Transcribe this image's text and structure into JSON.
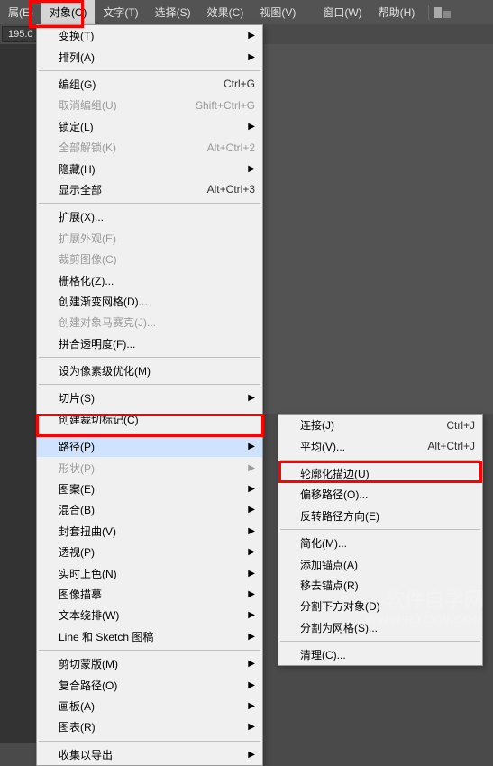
{
  "menubar": {
    "items": [
      {
        "label": "属(E)"
      },
      {
        "label": "对象(O)"
      },
      {
        "label": "文字(T)"
      },
      {
        "label": "选择(S)"
      },
      {
        "label": "效果(C)"
      },
      {
        "label": "视图(V)"
      },
      {
        "label": "窗口(W)"
      },
      {
        "label": "帮助(H)"
      }
    ]
  },
  "toolbar": {
    "value": "195.0"
  },
  "dropdown_main": [
    {
      "type": "item",
      "label": "变换(T)",
      "arrow": true
    },
    {
      "type": "item",
      "label": "排列(A)",
      "arrow": true
    },
    {
      "type": "sep"
    },
    {
      "type": "item",
      "label": "编组(G)",
      "shortcut": "Ctrl+G"
    },
    {
      "type": "item",
      "label": "取消编组(U)",
      "shortcut": "Shift+Ctrl+G",
      "disabled": true
    },
    {
      "type": "item",
      "label": "锁定(L)",
      "arrow": true
    },
    {
      "type": "item",
      "label": "全部解锁(K)",
      "shortcut": "Alt+Ctrl+2",
      "disabled": true
    },
    {
      "type": "item",
      "label": "隐藏(H)",
      "arrow": true
    },
    {
      "type": "item",
      "label": "显示全部",
      "shortcut": "Alt+Ctrl+3"
    },
    {
      "type": "sep"
    },
    {
      "type": "item",
      "label": "扩展(X)..."
    },
    {
      "type": "item",
      "label": "扩展外观(E)",
      "disabled": true
    },
    {
      "type": "item",
      "label": "裁剪图像(C)",
      "disabled": true
    },
    {
      "type": "item",
      "label": "栅格化(Z)..."
    },
    {
      "type": "item",
      "label": "创建渐变网格(D)..."
    },
    {
      "type": "item",
      "label": "创建对象马赛克(J)...",
      "disabled": true
    },
    {
      "type": "item",
      "label": "拼合透明度(F)..."
    },
    {
      "type": "sep"
    },
    {
      "type": "item",
      "label": "设为像素级优化(M)"
    },
    {
      "type": "sep"
    },
    {
      "type": "item",
      "label": "切片(S)",
      "arrow": true
    },
    {
      "type": "item",
      "label": "创建裁切标记(C)"
    },
    {
      "type": "sep"
    },
    {
      "type": "item",
      "label": "路径(P)",
      "arrow": true,
      "highlighted": true
    },
    {
      "type": "item",
      "label": "形状(P)",
      "arrow": true,
      "disabled": true
    },
    {
      "type": "item",
      "label": "图案(E)",
      "arrow": true
    },
    {
      "type": "item",
      "label": "混合(B)",
      "arrow": true
    },
    {
      "type": "item",
      "label": "封套扭曲(V)",
      "arrow": true
    },
    {
      "type": "item",
      "label": "透视(P)",
      "arrow": true
    },
    {
      "type": "item",
      "label": "实时上色(N)",
      "arrow": true
    },
    {
      "type": "item",
      "label": "图像描摹",
      "arrow": true
    },
    {
      "type": "item",
      "label": "文本绕排(W)",
      "arrow": true
    },
    {
      "type": "item",
      "label": "Line 和 Sketch 图稿",
      "arrow": true
    },
    {
      "type": "sep"
    },
    {
      "type": "item",
      "label": "剪切蒙版(M)",
      "arrow": true
    },
    {
      "type": "item",
      "label": "复合路径(O)",
      "arrow": true
    },
    {
      "type": "item",
      "label": "画板(A)",
      "arrow": true
    },
    {
      "type": "item",
      "label": "图表(R)",
      "arrow": true
    },
    {
      "type": "sep"
    },
    {
      "type": "item",
      "label": "收集以导出",
      "arrow": true
    }
  ],
  "dropdown_sub": [
    {
      "type": "item",
      "label": "连接(J)",
      "shortcut": "Ctrl+J"
    },
    {
      "type": "item",
      "label": "平均(V)...",
      "shortcut": "Alt+Ctrl+J"
    },
    {
      "type": "sep"
    },
    {
      "type": "item",
      "label": "轮廓化描边(U)"
    },
    {
      "type": "item",
      "label": "偏移路径(O)..."
    },
    {
      "type": "item",
      "label": "反转路径方向(E)"
    },
    {
      "type": "sep"
    },
    {
      "type": "item",
      "label": "简化(M)..."
    },
    {
      "type": "item",
      "label": "添加锚点(A)"
    },
    {
      "type": "item",
      "label": "移去锚点(R)"
    },
    {
      "type": "item",
      "label": "分割下方对象(D)"
    },
    {
      "type": "item",
      "label": "分割为网格(S)..."
    },
    {
      "type": "sep"
    },
    {
      "type": "item",
      "label": "清理(C)..."
    }
  ],
  "watermark": {
    "main": "软件自学网",
    "sub": "WWW.RJZXW.COM"
  }
}
